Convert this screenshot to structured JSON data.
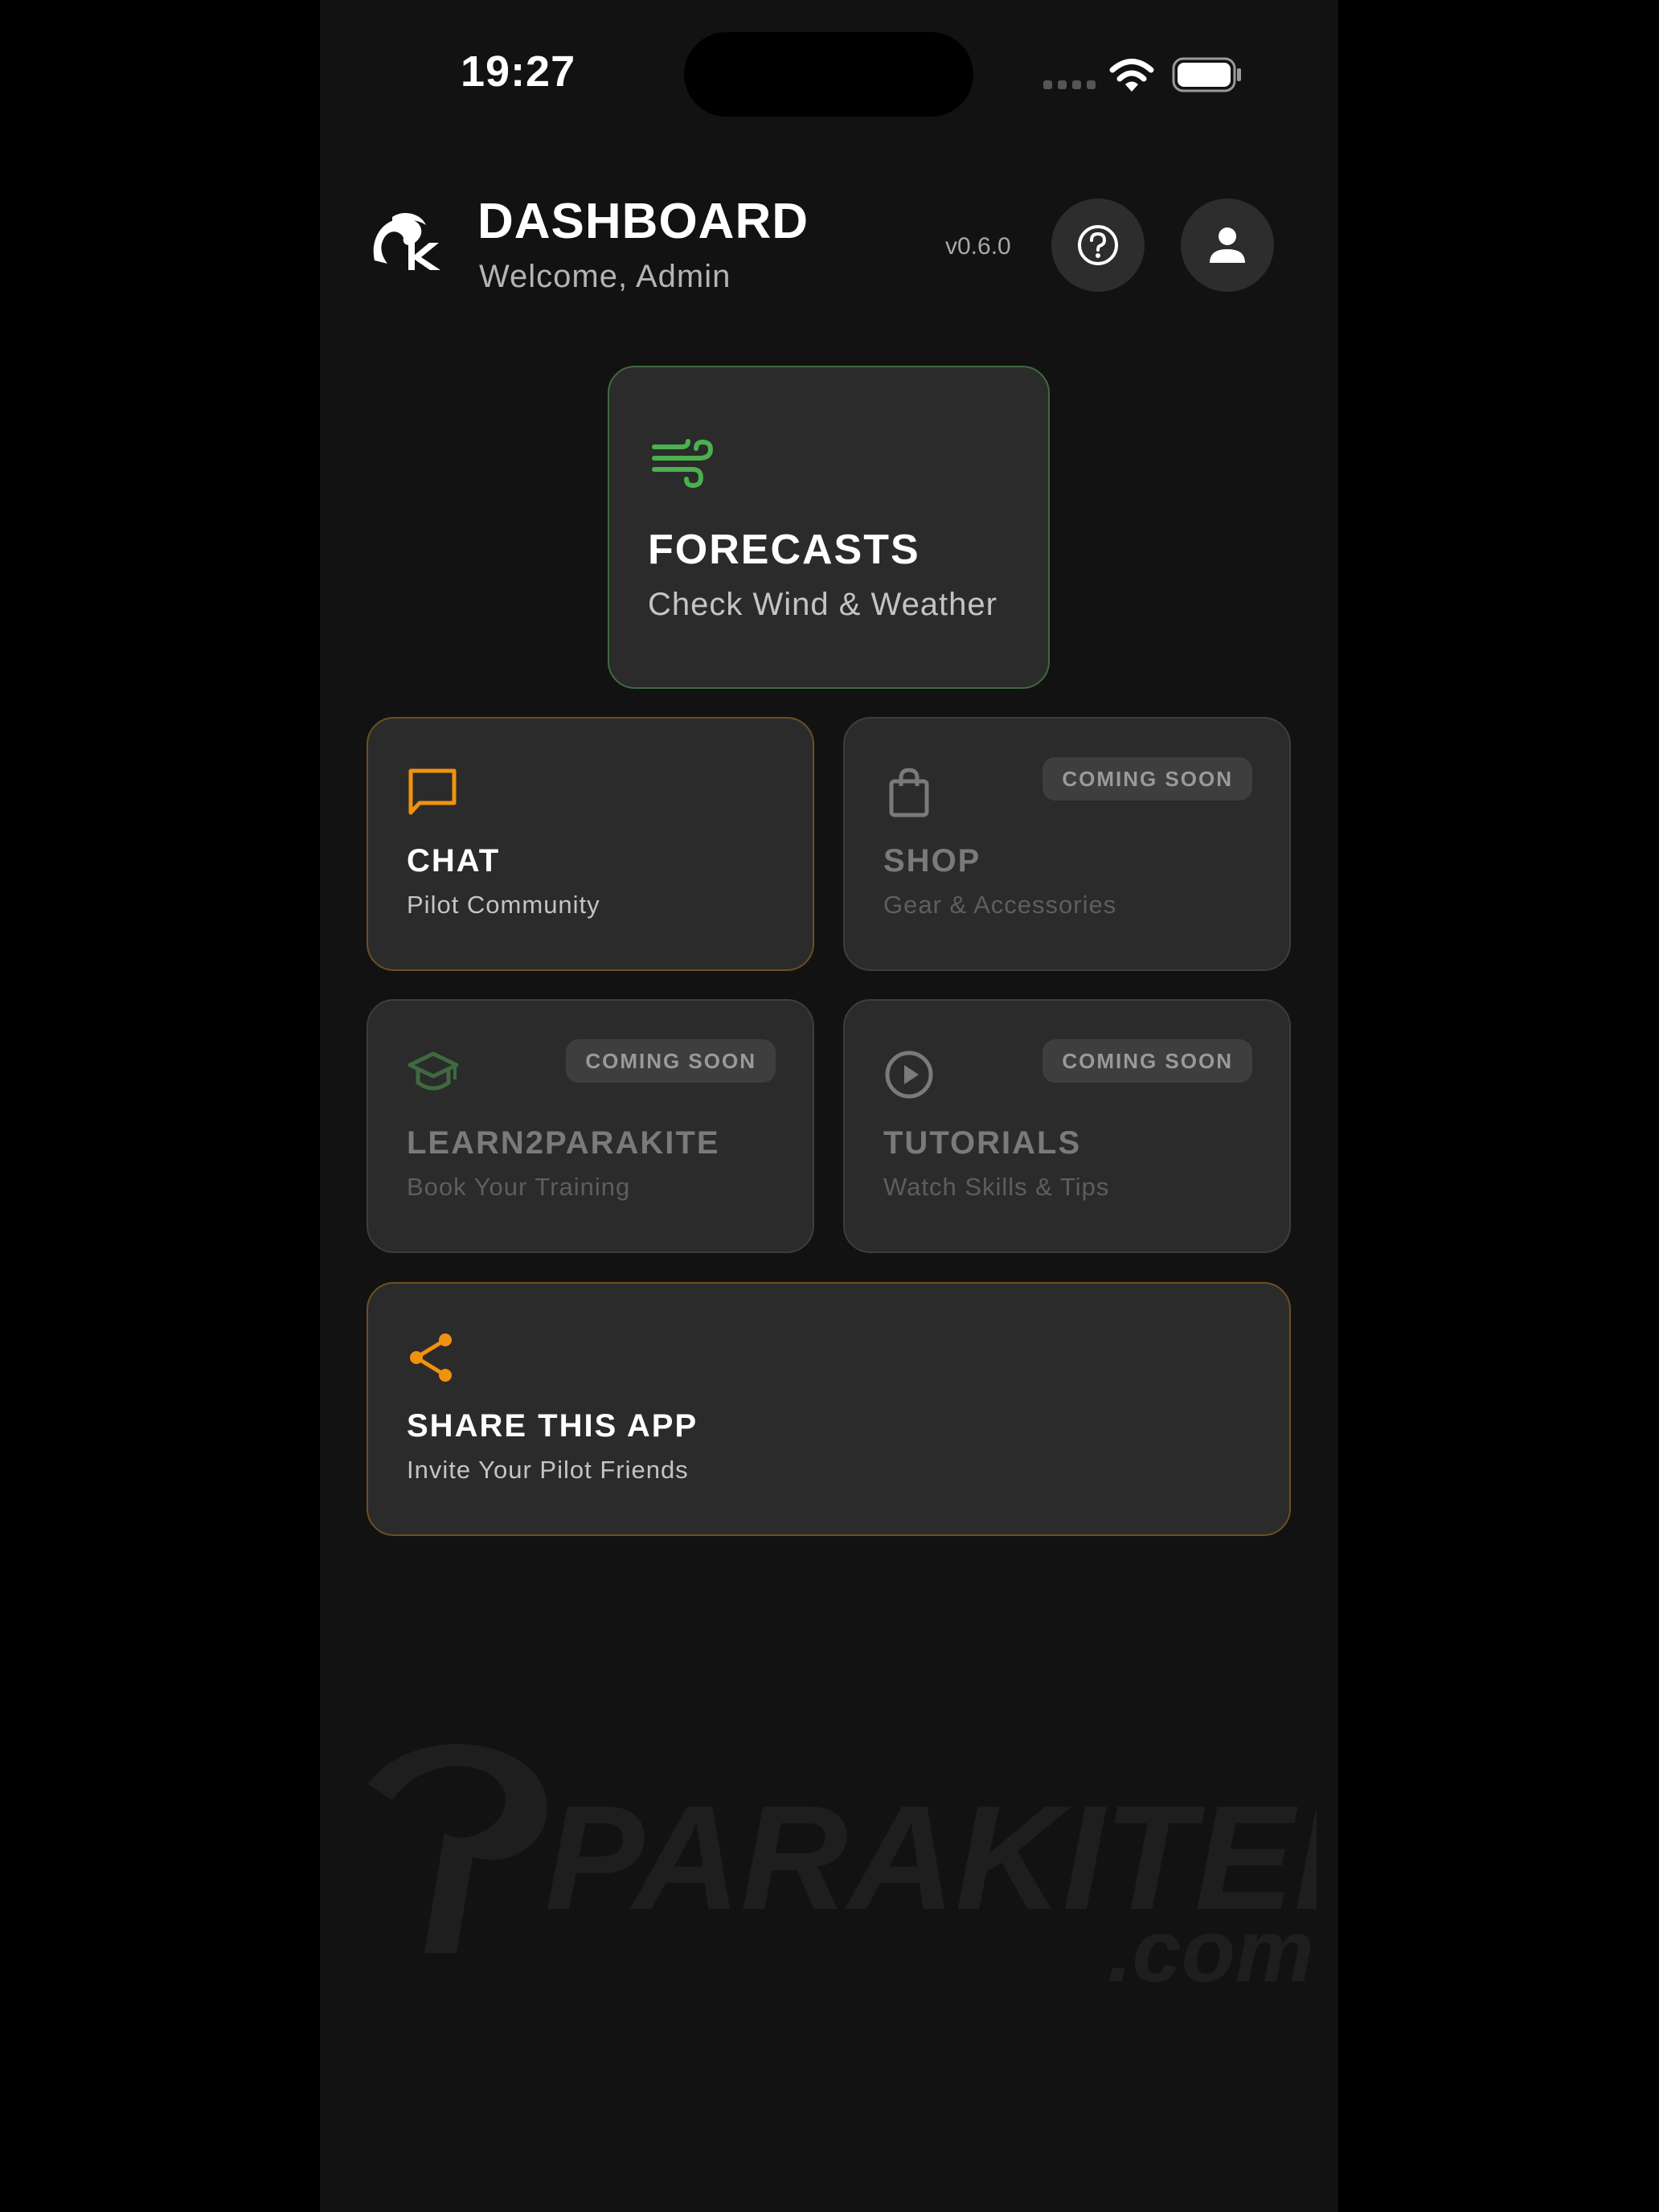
{
  "status_bar": {
    "time": "19:27"
  },
  "header": {
    "title": "DASHBOARD",
    "subtitle": "Welcome, Admin",
    "version": "v0.6.0",
    "help_icon": "question-circle-icon",
    "profile_icon": "person-icon"
  },
  "cards": {
    "forecasts": {
      "title": "FORECASTS",
      "subtitle": "Check Wind & Weather",
      "icon": "wind-icon",
      "accent": "#4caf50"
    },
    "chat": {
      "title": "CHAT",
      "subtitle": "Pilot Community",
      "icon": "chat-bubble-icon",
      "accent": "#f0920f"
    },
    "shop": {
      "title": "SHOP",
      "subtitle": "Gear & Accessories",
      "icon": "shopping-bag-icon",
      "badge": "COMING SOON"
    },
    "learn": {
      "title": "LEARN2PARAKITE",
      "subtitle": "Book Your Training",
      "icon": "graduation-cap-icon",
      "badge": "COMING SOON"
    },
    "tutorials": {
      "title": "TUTORIALS",
      "subtitle": "Watch Skills & Tips",
      "icon": "play-circle-icon",
      "badge": "COMING SOON"
    },
    "share": {
      "title": "SHARE THIS APP",
      "subtitle": "Invite Your Pilot Friends",
      "icon": "share-icon",
      "accent": "#f0920f"
    }
  },
  "watermark": {
    "brand": "PARAKITER",
    "suffix": ".com"
  }
}
